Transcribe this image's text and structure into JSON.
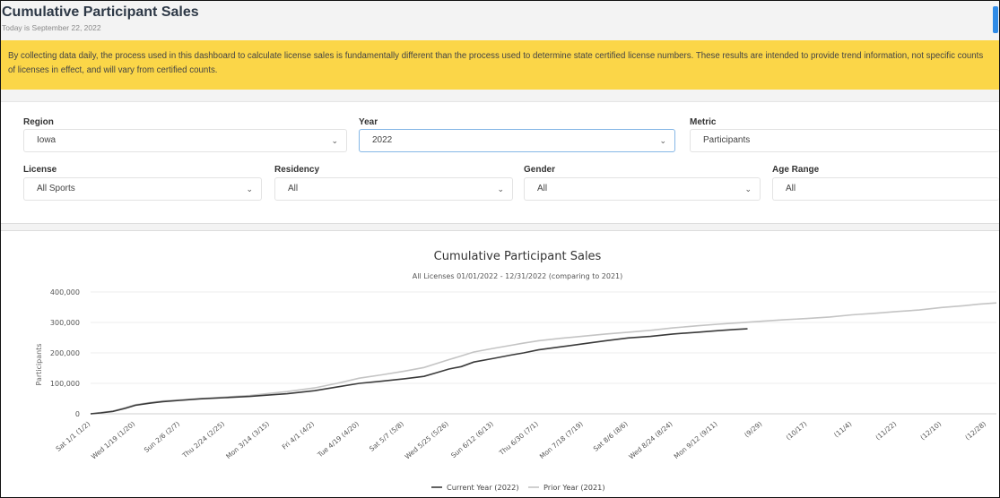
{
  "header": {
    "title": "Cumulative Participant Sales",
    "date_text": "Today is September 22, 2022"
  },
  "notice": {
    "text": "By collecting data daily, the process used in this dashboard to calculate license sales is fundamentally different than the process used to determine state certified license numbers. These results are intended to provide trend information, not specific counts of licenses in effect, and will vary from certified counts."
  },
  "filters": {
    "region": {
      "label": "Region",
      "value": "Iowa"
    },
    "year": {
      "label": "Year",
      "value": "2022"
    },
    "metric": {
      "label": "Metric",
      "value": "Participants"
    },
    "license": {
      "label": "License",
      "value": "All Sports"
    },
    "residency": {
      "label": "Residency",
      "value": "All"
    },
    "gender": {
      "label": "Gender",
      "value": "All"
    },
    "age_range": {
      "label": "Age Range",
      "value": "All"
    }
  },
  "colors": {
    "current": "#3a3a3a",
    "prior": "#c4c4c4",
    "notice_bg": "#fbd648",
    "scroll_accent": "#2f8be6"
  },
  "chart_data": {
    "type": "line",
    "title": "Cumulative Participant Sales",
    "subtitle": "All Licenses 01/01/2022 - 12/31/2022 (comparing to 2021)",
    "ylabel": "Participants",
    "xlabel": "",
    "ylim": [
      0,
      400000
    ],
    "yticks": [
      0,
      100000,
      200000,
      300000,
      400000
    ],
    "ytick_labels": [
      "0",
      "100,000",
      "200,000",
      "300,000",
      "400,000"
    ],
    "xlim_day": [
      1,
      365
    ],
    "x_ticks": [
      {
        "day": 1,
        "label": "Sat 1/1 (1/2)"
      },
      {
        "day": 19,
        "label": "Wed 1/19 (1/20)"
      },
      {
        "day": 37,
        "label": "Sun 2/6 (2/7)"
      },
      {
        "day": 55,
        "label": "Thu 2/24 (2/25)"
      },
      {
        "day": 73,
        "label": "Mon 3/14 (3/15)"
      },
      {
        "day": 91,
        "label": "Fri 4/1 (4/2)"
      },
      {
        "day": 109,
        "label": "Tue 4/19 (4/20)"
      },
      {
        "day": 127,
        "label": "Sat 5/7 (5/8)"
      },
      {
        "day": 145,
        "label": "Wed 5/25 (5/26)"
      },
      {
        "day": 163,
        "label": "Sun 6/12 (6/13)"
      },
      {
        "day": 181,
        "label": "Thu 6/30 (7/1)"
      },
      {
        "day": 199,
        "label": "Mon 7/18 (7/19)"
      },
      {
        "day": 217,
        "label": "Sat 8/6 (8/6)"
      },
      {
        "day": 235,
        "label": "Wed 8/24 (8/24)"
      },
      {
        "day": 253,
        "label": "Mon 9/12 (9/11)"
      },
      {
        "day": 271,
        "label": "(9/29)"
      },
      {
        "day": 289,
        "label": "(10/17)"
      },
      {
        "day": 307,
        "label": "(11/4)"
      },
      {
        "day": 325,
        "label": "(11/22)"
      },
      {
        "day": 343,
        "label": "(12/10)"
      },
      {
        "day": 361,
        "label": "(12/28)"
      }
    ],
    "legend_position": "bottom-center",
    "grid": "horizontal",
    "series": [
      {
        "name": "Current Year (2022)",
        "color": "#3a3a3a",
        "points": [
          [
            1,
            0
          ],
          [
            5,
            3000
          ],
          [
            10,
            8000
          ],
          [
            15,
            18000
          ],
          [
            19,
            28000
          ],
          [
            25,
            35000
          ],
          [
            30,
            40000
          ],
          [
            37,
            44000
          ],
          [
            45,
            49000
          ],
          [
            55,
            53000
          ],
          [
            65,
            57000
          ],
          [
            73,
            62000
          ],
          [
            80,
            66000
          ],
          [
            91,
            76000
          ],
          [
            100,
            88000
          ],
          [
            109,
            100000
          ],
          [
            118,
            107000
          ],
          [
            127,
            115000
          ],
          [
            135,
            123000
          ],
          [
            140,
            135000
          ],
          [
            145,
            147000
          ],
          [
            150,
            155000
          ],
          [
            155,
            170000
          ],
          [
            163,
            182000
          ],
          [
            170,
            193000
          ],
          [
            175,
            200000
          ],
          [
            181,
            210000
          ],
          [
            190,
            220000
          ],
          [
            199,
            230000
          ],
          [
            208,
            240000
          ],
          [
            217,
            249000
          ],
          [
            226,
            254000
          ],
          [
            235,
            262000
          ],
          [
            245,
            268000
          ],
          [
            253,
            273000
          ],
          [
            260,
            277000
          ],
          [
            265,
            279000
          ]
        ]
      },
      {
        "name": "Prior Year (2021)",
        "color": "#c4c4c4",
        "points": [
          [
            1,
            0
          ],
          [
            5,
            4000
          ],
          [
            10,
            9000
          ],
          [
            15,
            20000
          ],
          [
            19,
            30000
          ],
          [
            25,
            37000
          ],
          [
            30,
            42000
          ],
          [
            37,
            46000
          ],
          [
            45,
            50000
          ],
          [
            55,
            55000
          ],
          [
            65,
            60000
          ],
          [
            73,
            67000
          ],
          [
            80,
            73000
          ],
          [
            91,
            85000
          ],
          [
            100,
            100000
          ],
          [
            109,
            117000
          ],
          [
            118,
            128000
          ],
          [
            127,
            140000
          ],
          [
            135,
            152000
          ],
          [
            140,
            165000
          ],
          [
            145,
            178000
          ],
          [
            150,
            190000
          ],
          [
            155,
            203000
          ],
          [
            163,
            215000
          ],
          [
            170,
            225000
          ],
          [
            175,
            232000
          ],
          [
            181,
            240000
          ],
          [
            190,
            248000
          ],
          [
            199,
            255000
          ],
          [
            208,
            262000
          ],
          [
            217,
            268000
          ],
          [
            226,
            274000
          ],
          [
            235,
            282000
          ],
          [
            245,
            289000
          ],
          [
            253,
            294000
          ],
          [
            262,
            299000
          ],
          [
            271,
            304000
          ],
          [
            280,
            309000
          ],
          [
            289,
            313000
          ],
          [
            298,
            318000
          ],
          [
            307,
            325000
          ],
          [
            316,
            330000
          ],
          [
            325,
            336000
          ],
          [
            334,
            341000
          ],
          [
            343,
            349000
          ],
          [
            352,
            355000
          ],
          [
            358,
            360000
          ],
          [
            365,
            364000
          ]
        ]
      }
    ]
  }
}
